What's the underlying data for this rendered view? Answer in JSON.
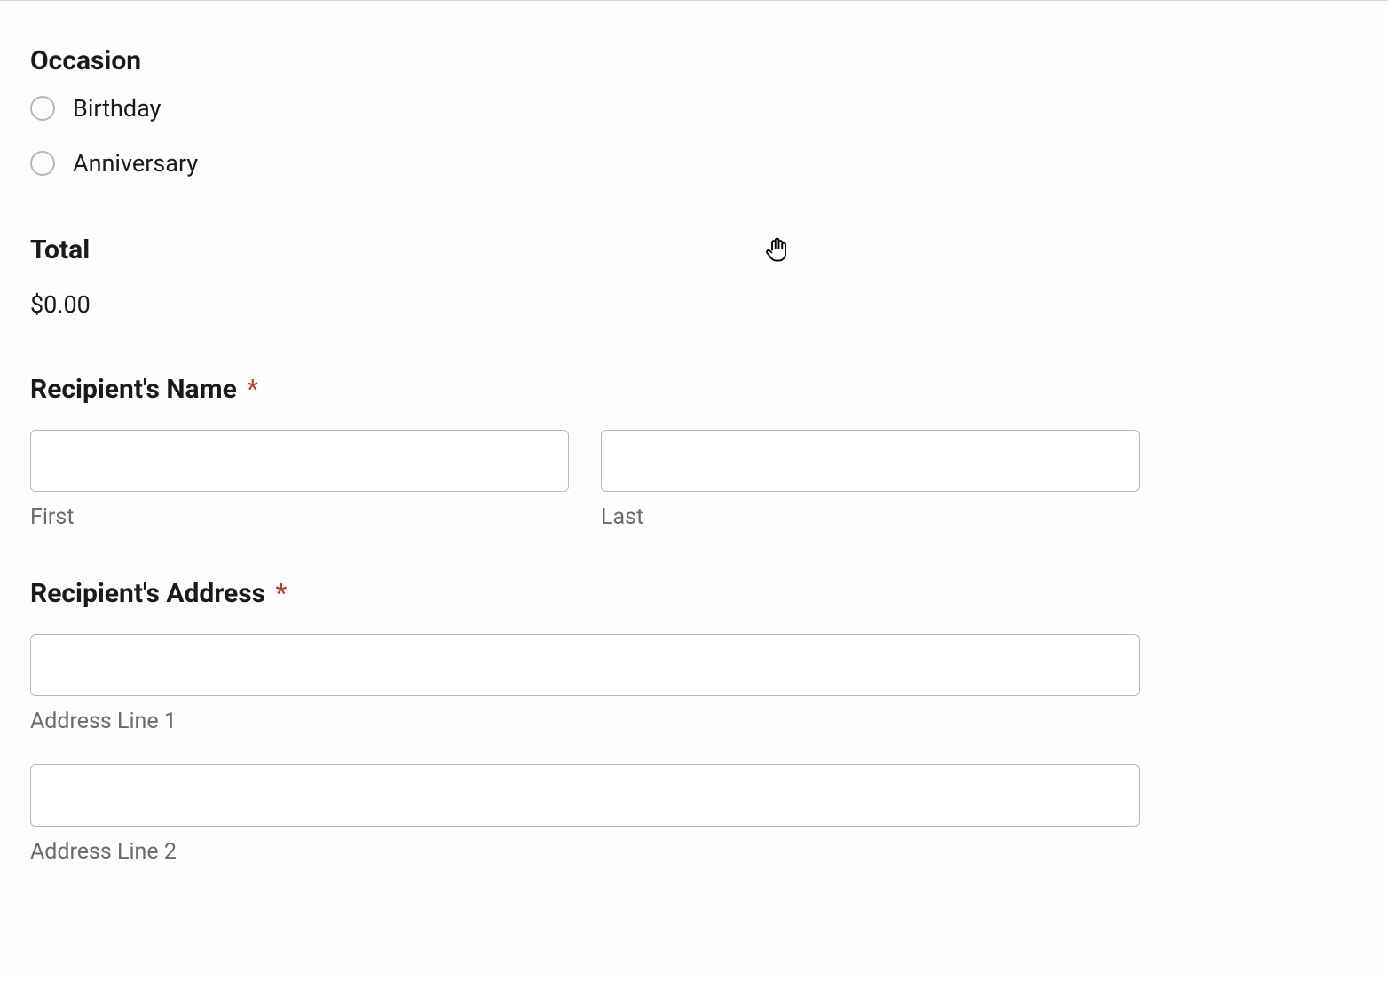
{
  "occasion": {
    "heading": "Occasion",
    "options": [
      {
        "label": "Birthday"
      },
      {
        "label": "Anniversary"
      }
    ]
  },
  "total": {
    "heading": "Total",
    "value": "$0.00"
  },
  "recipientName": {
    "heading": "Recipient's Name",
    "required": "*",
    "firstLabel": "First",
    "lastLabel": "Last",
    "firstValue": "",
    "lastValue": ""
  },
  "recipientAddress": {
    "heading": "Recipient's Address",
    "required": "*",
    "line1Label": "Address Line 1",
    "line2Label": "Address Line 2",
    "line1Value": "",
    "line2Value": ""
  }
}
